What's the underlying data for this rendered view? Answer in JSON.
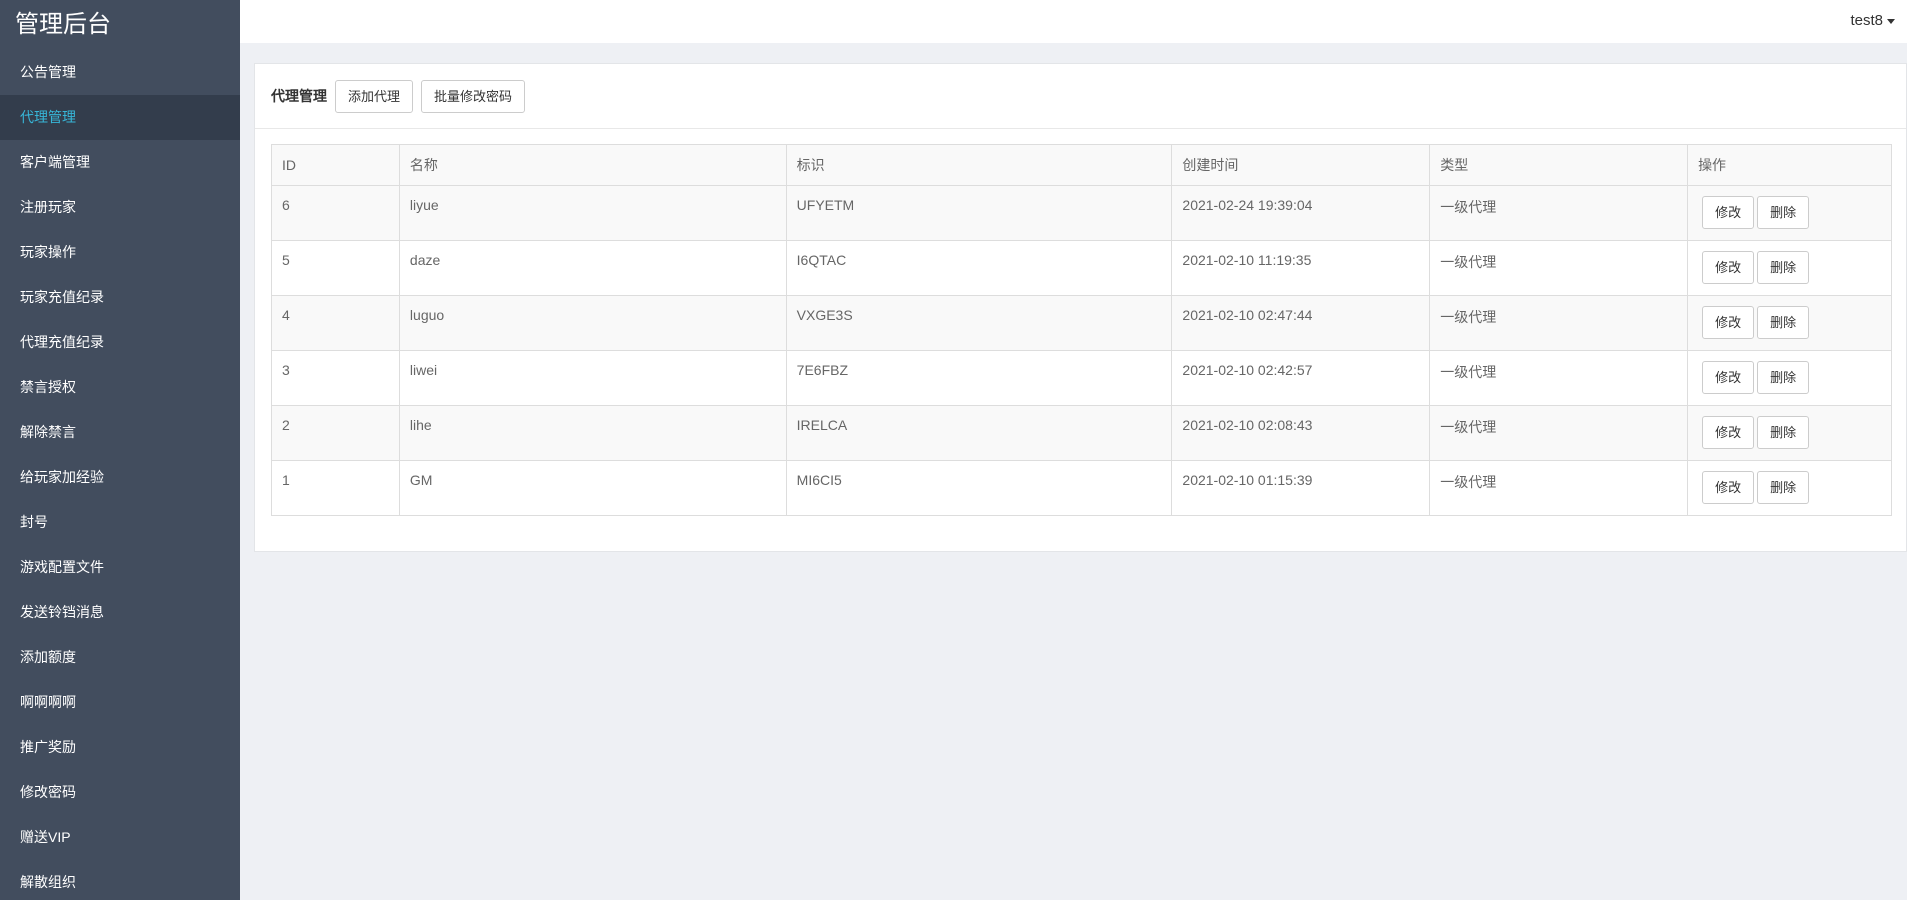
{
  "app": {
    "title": "管理后台"
  },
  "sidebar": {
    "items": [
      {
        "label": "公告管理"
      },
      {
        "label": "代理管理",
        "active": true
      },
      {
        "label": "客户端管理"
      },
      {
        "label": "注册玩家"
      },
      {
        "label": "玩家操作"
      },
      {
        "label": "玩家充值纪录"
      },
      {
        "label": "代理充值纪录"
      },
      {
        "label": "禁言授权"
      },
      {
        "label": "解除禁言"
      },
      {
        "label": "给玩家加经验"
      },
      {
        "label": "封号"
      },
      {
        "label": "游戏配置文件"
      },
      {
        "label": "发送铃铛消息"
      },
      {
        "label": "添加额度"
      },
      {
        "label": "啊啊啊啊"
      },
      {
        "label": "推广奖励"
      },
      {
        "label": "修改密码"
      },
      {
        "label": "赠送VIP"
      },
      {
        "label": "解散组织"
      }
    ]
  },
  "topbar": {
    "user": "test8"
  },
  "panel": {
    "title": "代理管理",
    "add_button": "添加代理",
    "batch_button": "批量修改密码"
  },
  "table": {
    "headers": [
      "ID",
      "名称",
      "标识",
      "创建时间",
      "类型",
      "操作"
    ],
    "rows": [
      {
        "id": "6",
        "name": "liyue",
        "code": "UFYETM",
        "created": "2021-02-24 19:39:04",
        "type": "一级代理"
      },
      {
        "id": "5",
        "name": "daze",
        "code": "I6QTAC",
        "created": "2021-02-10 11:19:35",
        "type": "一级代理"
      },
      {
        "id": "4",
        "name": "luguo",
        "code": "VXGE3S",
        "created": "2021-02-10 02:47:44",
        "type": "一级代理"
      },
      {
        "id": "3",
        "name": "liwei",
        "code": "7E6FBZ",
        "created": "2021-02-10 02:42:57",
        "type": "一级代理"
      },
      {
        "id": "2",
        "name": "lihe",
        "code": "IRELCA",
        "created": "2021-02-10 02:08:43",
        "type": "一级代理"
      },
      {
        "id": "1",
        "name": "GM",
        "code": "MI6CI5",
        "created": "2021-02-10 01:15:39",
        "type": "一级代理"
      }
    ],
    "edit_label": "修改",
    "delete_label": "删除"
  },
  "colors": {
    "sidebar_bg": "#424d5e",
    "sidebar_active_bg": "#333d4c",
    "accent": "#37b6d8",
    "page_bg": "#eef0f4"
  }
}
